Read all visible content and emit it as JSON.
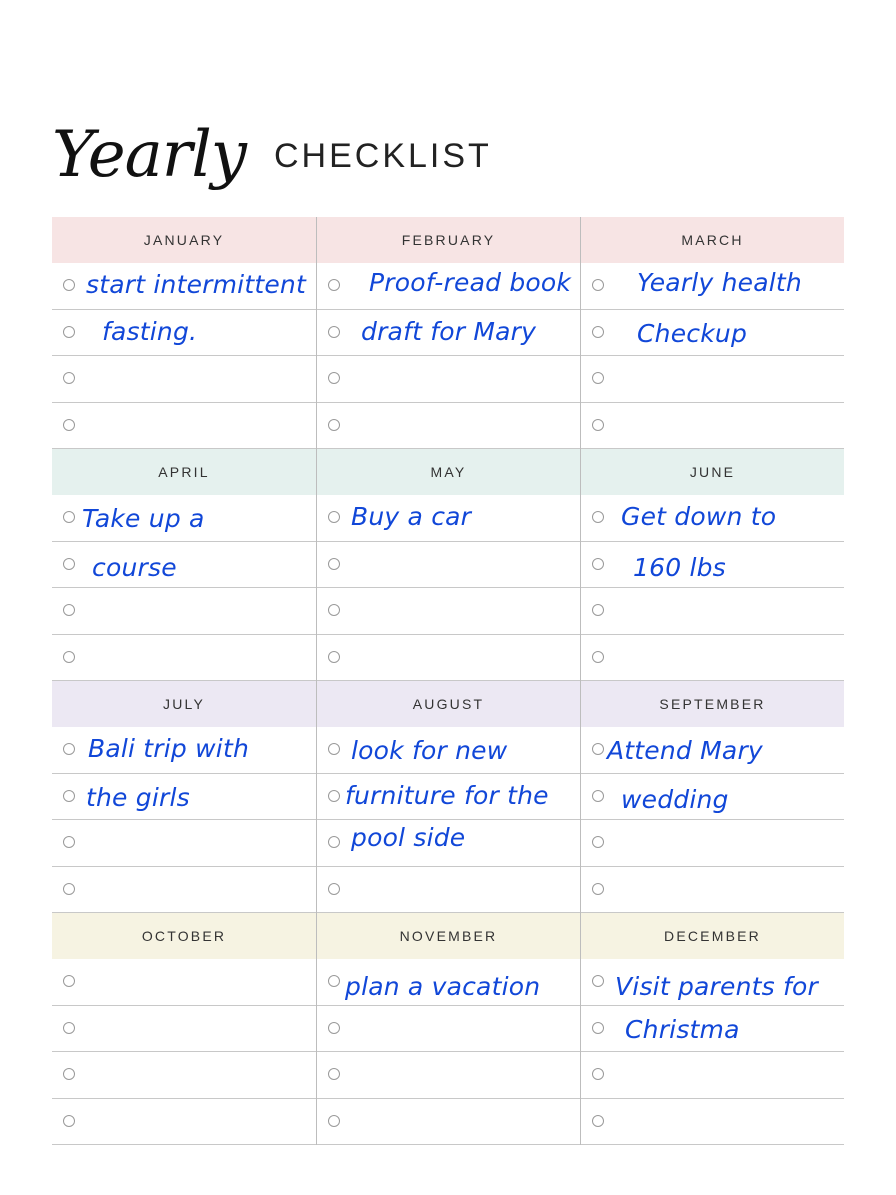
{
  "title": {
    "script": "Yearly",
    "main": "CHECKLIST"
  },
  "colors": {
    "handwriting": "#1147d8",
    "q1": "#f7e4e4",
    "q2": "#e5f1ee",
    "q3": "#ece8f3",
    "q4": "#f6f3e2"
  },
  "months": [
    {
      "name": "JANUARY",
      "entries": [
        "start intermittent",
        "fasting.",
        "",
        ""
      ]
    },
    {
      "name": "FEBRUARY",
      "entries": [
        "Proof-read book",
        "draft for Mary",
        "",
        ""
      ]
    },
    {
      "name": "MARCH",
      "entries": [
        "Yearly  health",
        "Checkup",
        "",
        ""
      ]
    },
    {
      "name": "APRIL",
      "entries": [
        "Take up a",
        "course",
        "",
        ""
      ]
    },
    {
      "name": "MAY",
      "entries": [
        "Buy a car",
        "",
        "",
        ""
      ]
    },
    {
      "name": "JUNE",
      "entries": [
        "Get down to",
        "160 lbs",
        "",
        ""
      ]
    },
    {
      "name": "JULY",
      "entries": [
        "Bali trip with",
        "the girls",
        "",
        ""
      ]
    },
    {
      "name": "AUGUST",
      "entries": [
        "look for new",
        "furniture for the",
        "pool side",
        ""
      ]
    },
    {
      "name": "SEPTEMBER",
      "entries": [
        "Attend Mary",
        "wedding",
        "",
        ""
      ]
    },
    {
      "name": "OCTOBER",
      "entries": [
        "",
        "",
        "",
        ""
      ]
    },
    {
      "name": "NOVEMBER",
      "entries": [
        "plan a vacation",
        "",
        "",
        ""
      ]
    },
    {
      "name": "DECEMBER",
      "entries": [
        "Visit parents for",
        "Christma",
        "",
        ""
      ]
    }
  ]
}
